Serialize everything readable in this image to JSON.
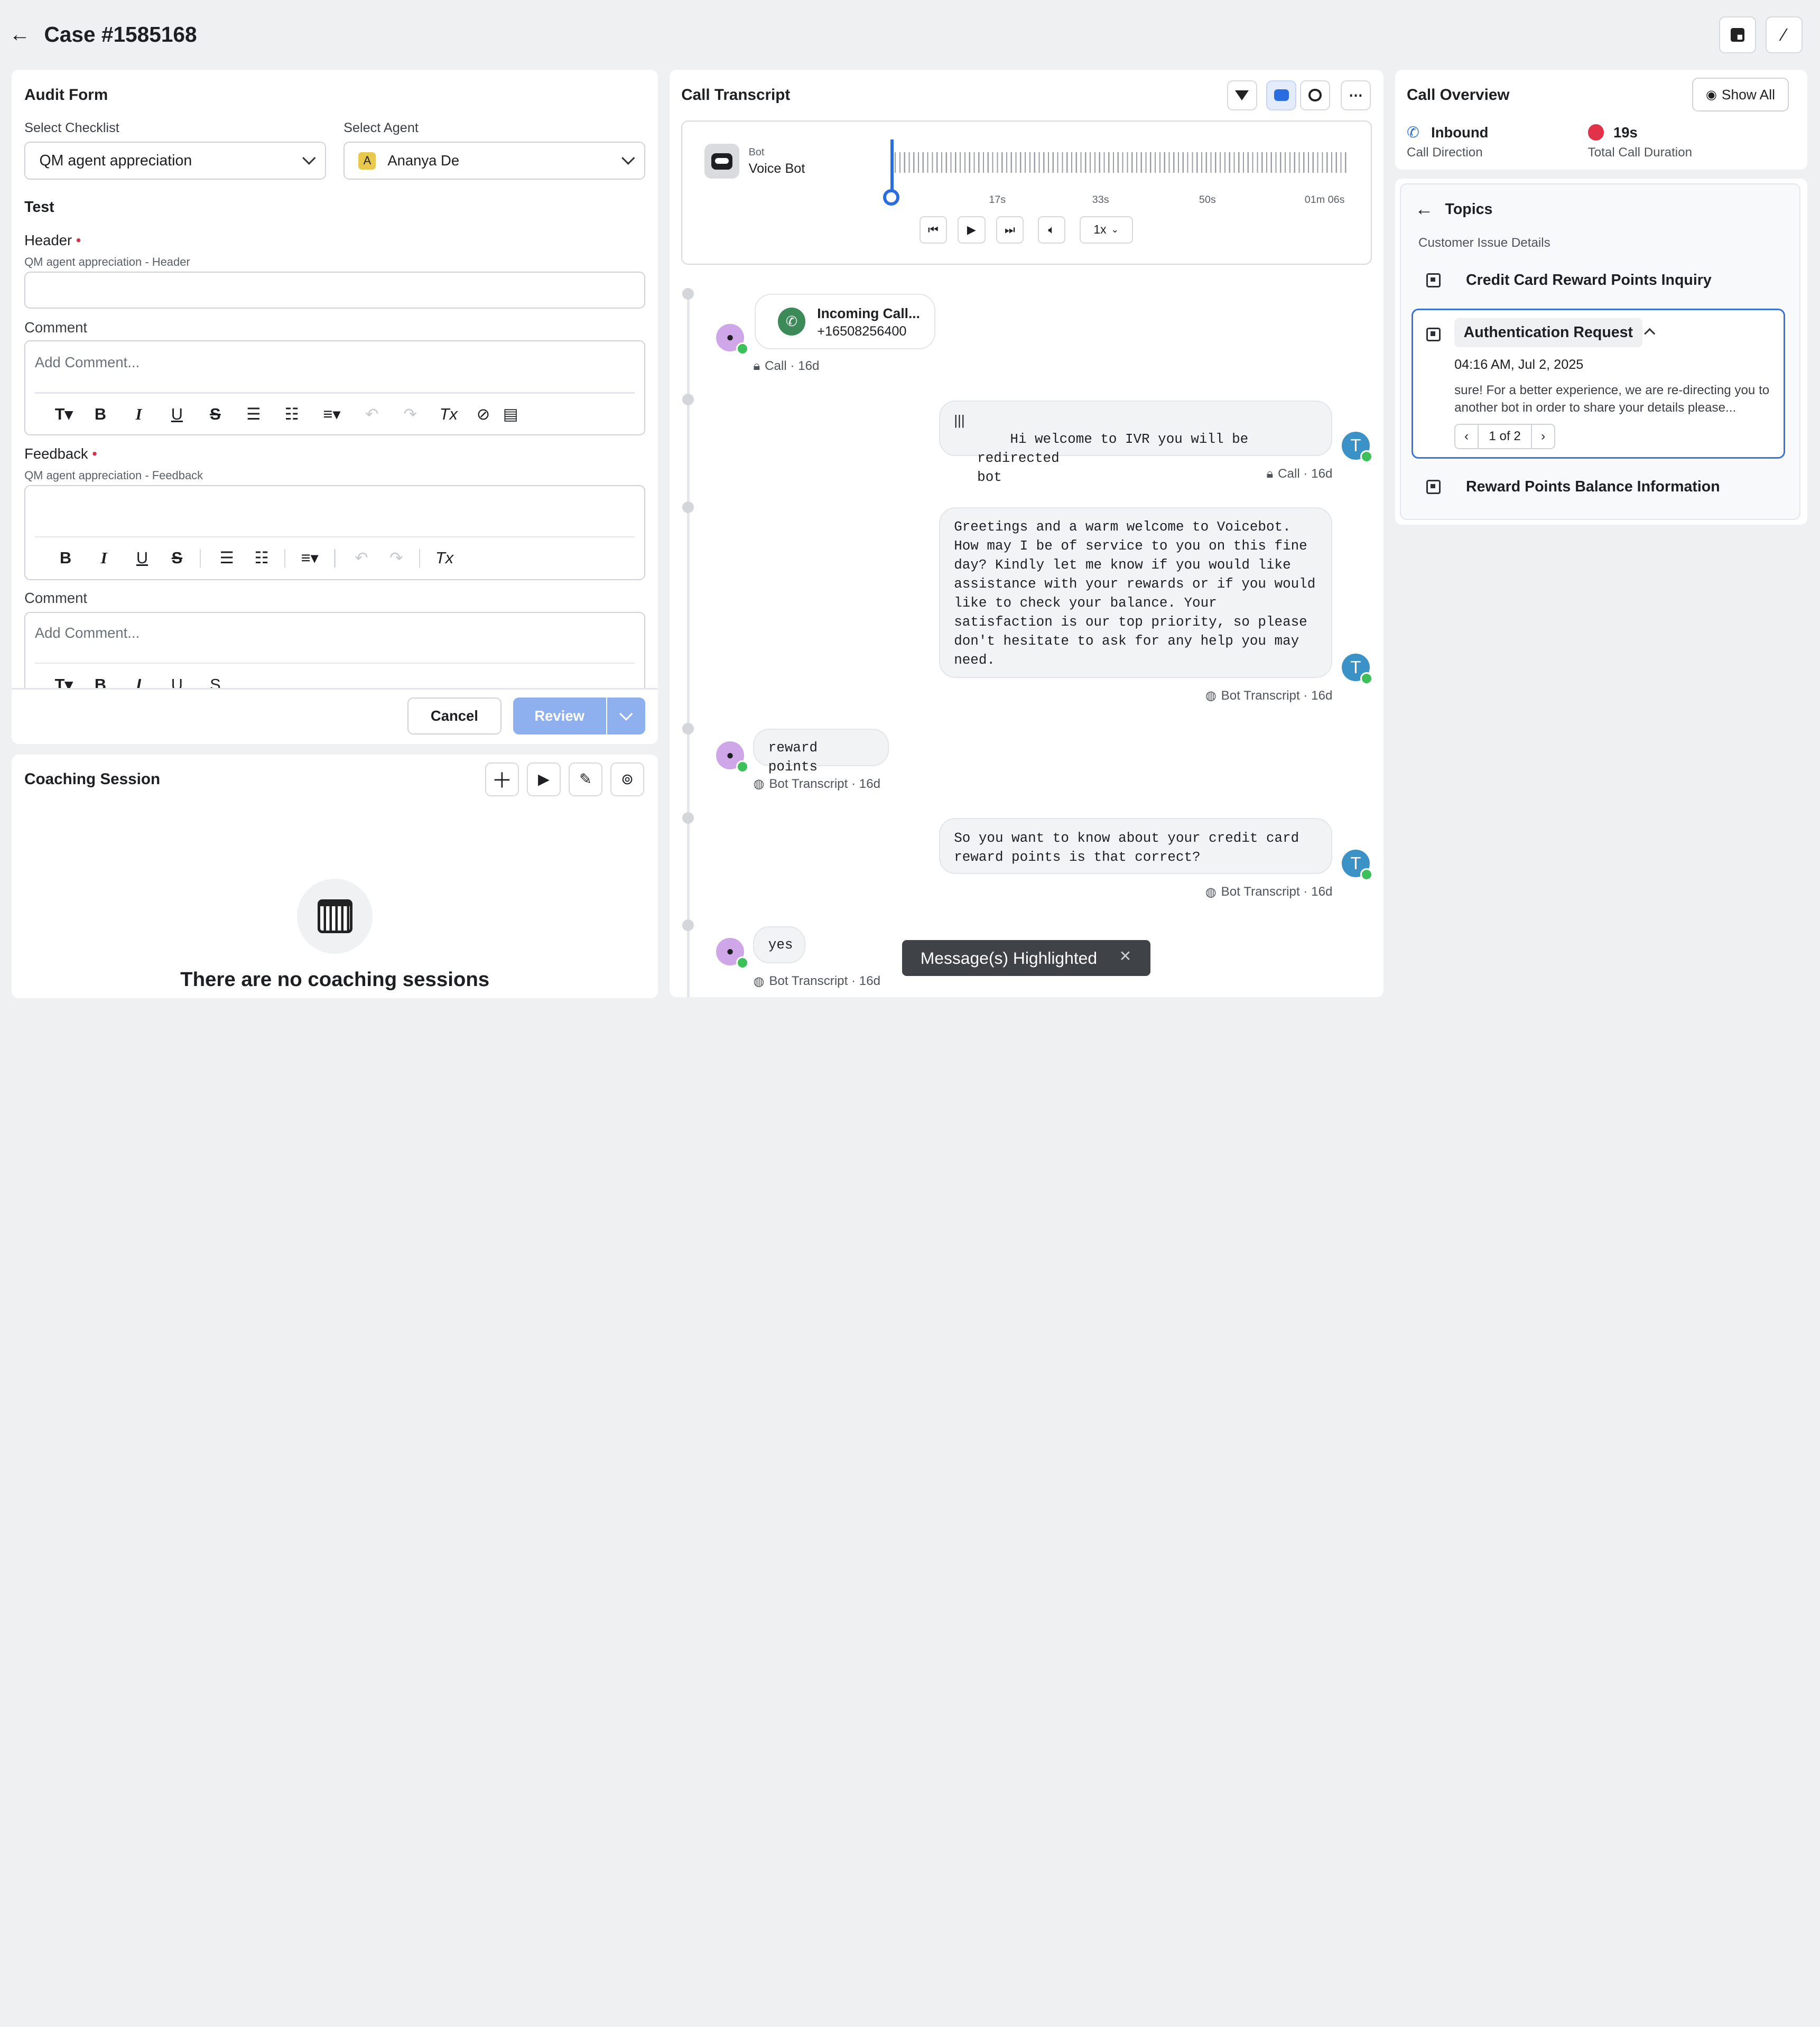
{
  "header": {
    "title": "Case #1585168"
  },
  "audit_form": {
    "title": "Audit Form",
    "checklist_label": "Select Checklist",
    "checklist_value": "QM agent appreciation",
    "agent_label": "Select Agent",
    "agent_initial": "A",
    "agent_value": "Ananya De",
    "section": "Test",
    "header_label": "Header",
    "header_sub": "QM agent appreciation - Header",
    "comment1_label": "Comment",
    "comment_placeholder": "Add Comment...",
    "feedback_label": "Feedback",
    "feedback_sub": "QM agent appreciation - Feedback",
    "comment2_label": "Comment",
    "cancel": "Cancel",
    "review": "Review"
  },
  "coaching": {
    "title": "Coaching Session",
    "empty": "There are no coaching sessions"
  },
  "transcript": {
    "title": "Call Transcript",
    "player": {
      "role": "Bot",
      "name": "Voice Bot",
      "ticks": [
        "17s",
        "33s",
        "50s",
        "01m 06s"
      ],
      "speed": "1x",
      "progress": 0
    },
    "incoming": {
      "title": "Incoming Call...",
      "number": "+16508256400",
      "meta": "Call · 16d"
    },
    "messages": [
      {
        "text": "Hi welcome to IVR you will be redirected\nbot",
        "meta": "Call · 16d",
        "avatar": "T"
      },
      {
        "text": "Greetings and a warm welcome to Voicebot.\nHow may I be of service to you on this fine\nday? Kindly let me know if you would like\nassistance with your rewards or if you would\nlike to check your balance. Your\nsatisfaction is our top priority, so please\ndon't hesitate to ask for any help you may\nneed.",
        "meta": "Bot Transcript · 16d",
        "avatar": "T"
      },
      {
        "text": "reward points",
        "meta": "Bot Transcript · 16d"
      },
      {
        "text": "So you want to know about your credit card\nreward points is that correct?",
        "meta": "Bot Transcript · 16d",
        "avatar": "T"
      },
      {
        "text": "yes",
        "meta": "Bot Transcript · 16d"
      }
    ],
    "toast": "Message(s) Highlighted"
  },
  "overview": {
    "title": "Call Overview",
    "show_all": "Show All",
    "direction_value": "Inbound",
    "direction_label": "Call Direction",
    "duration_value": "19s",
    "duration_label": "Total Call Duration"
  },
  "topics": {
    "title": "Topics",
    "group": "Customer Issue Details",
    "items": [
      "Credit Card Reward Points Inquiry",
      "Authentication Request",
      "Reward Points Balance Information"
    ],
    "active_time": "04:16 AM, Jul 2, 2025",
    "active_snippet": "sure! For a better experience, we are re-directing you to another bot in order to share your details please...",
    "pager": "1 of 2"
  },
  "colors": {
    "accent": "#2a6de0",
    "review": "#8fb0ef",
    "toast": "#3f4247",
    "duration": "#e0334a"
  }
}
